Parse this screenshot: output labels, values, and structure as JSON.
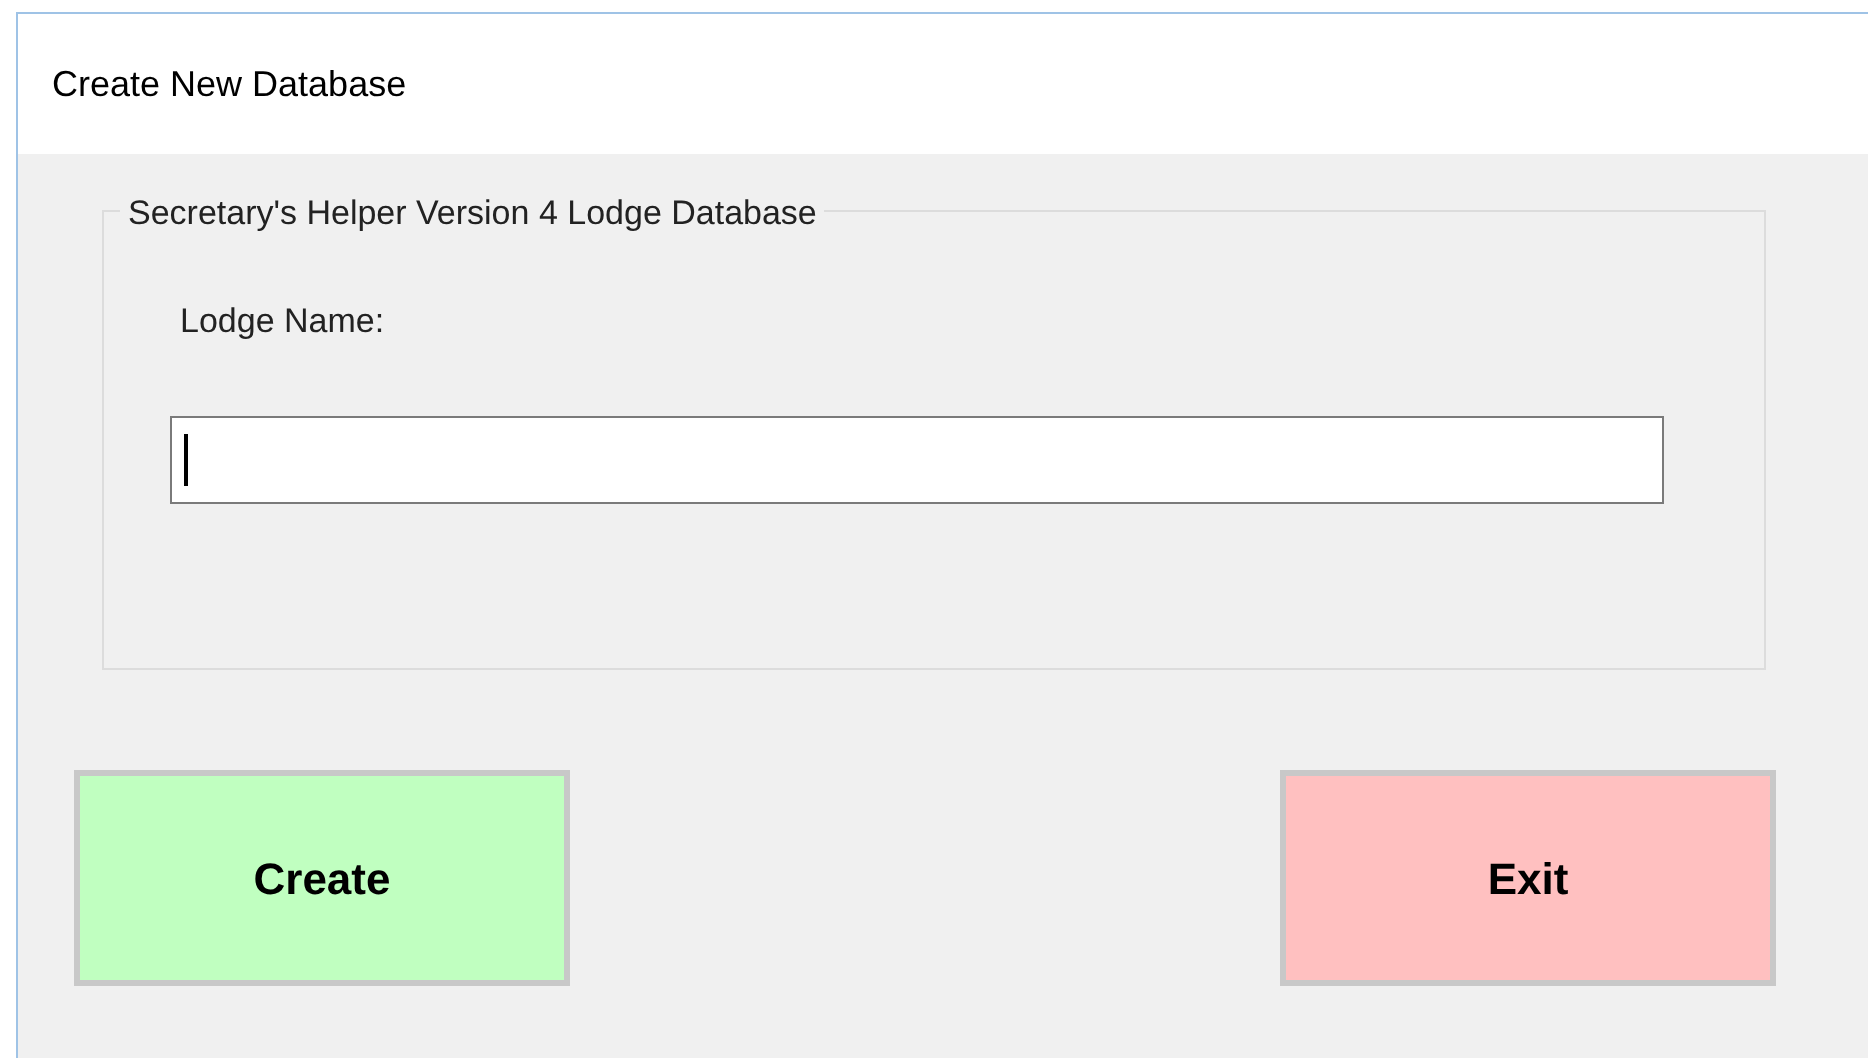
{
  "window": {
    "title": "Create New Database"
  },
  "group": {
    "legend": "Secretary's Helper Version 4 Lodge Database",
    "field": {
      "label": "Lodge Name:",
      "focused": true
    }
  },
  "buttons": [
    {
      "label": "Create",
      "color": "#c0ffc0"
    },
    {
      "label": "Exit",
      "color": "#ffc0c0"
    }
  ]
}
